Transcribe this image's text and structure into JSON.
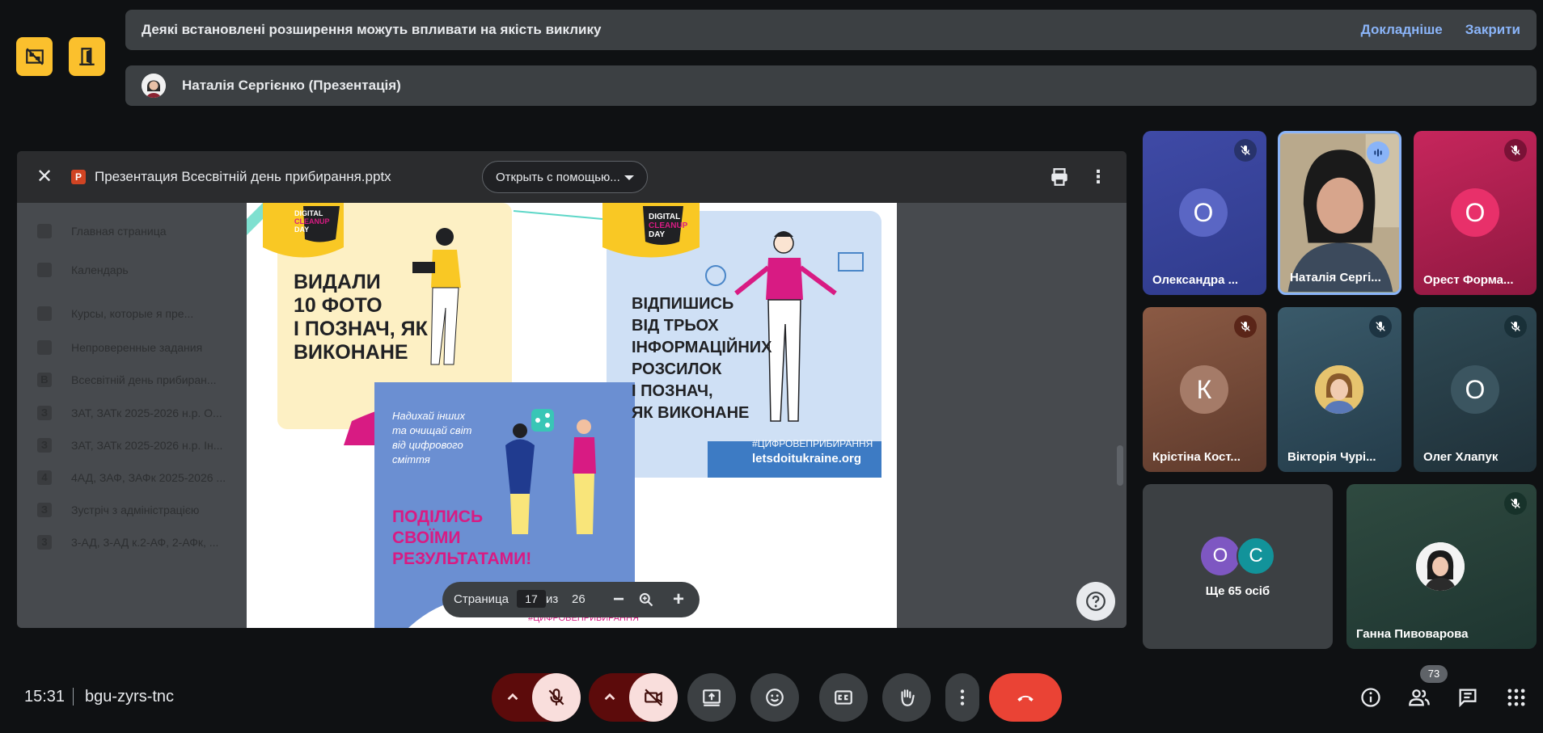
{
  "notice": {
    "message": "Деякі встановлені розширення можуть впливати на якість виклику",
    "learn_more": "Докладніше",
    "close": "Закрити"
  },
  "presenter": {
    "name": "Наталія Сергієнко (Презентація)"
  },
  "viewer": {
    "file_icon": "P",
    "file_name": "Презентация Всесвітній день прибирання.pptx",
    "open_with": "Открыть с помощью...",
    "background_items": [
      "Главная страница",
      "Календарь",
      "Курсы, которые я пре...",
      "Непроверенные задания",
      "Всесвітній день прибиран...",
      "ЗАТ, ЗАТк 2025-2026 н.р. О...",
      "ЗАТ, ЗАТк 2025-2026 н.р. Ін...",
      "4АД, ЗАФ, ЗАФк 2025-2026 ...",
      "Зустріч з адміністрацією",
      "3-АД, 3-АД к.2-АФ, 2-АФк, ..."
    ],
    "background_icons": [
      "",
      "",
      "",
      "",
      "В",
      "З",
      "З",
      "4",
      "З",
      "3"
    ],
    "pager": {
      "page_label": "Страница",
      "current": "17",
      "of_label": "из",
      "total": "26"
    }
  },
  "slide": {
    "logo_line1": "DIGITAL",
    "logo_line2": "CLEANUP",
    "logo_line3": "DAY",
    "panel1_title": [
      "ВИДАЛИ",
      "10 ФОТО",
      "І ПОЗНАЧ, ЯК",
      "ВИКОНАНЕ"
    ],
    "panel2_title": [
      "ВІДПИШИСЬ",
      "ВІД ТРЬОХ",
      "ІНФОРМАЦІЙНИХ",
      "РОЗСИЛОК",
      "І ПОЗНАЧ,",
      "ЯК ВИКОНАНЕ"
    ],
    "panel2_hashtag": "#ЦИФРОВЕПРИБИРАННЯ",
    "panel2_site": "letsdoitukraine.org",
    "panel3_intro": [
      "Надихай інших",
      "та очищай світ",
      "від цифрового",
      "сміття"
    ],
    "panel3_title": [
      "ПОДІЛИСЬ",
      "СВОЇМИ",
      "РЕЗУЛЬТАТАМИ!"
    ],
    "panel3_hashtag": "#ЦИФРОВЕПРИБИРАННЯ"
  },
  "participants": [
    {
      "name": "Олександра ...",
      "initial": "О",
      "muted": true
    },
    {
      "name": "Наталія Сергі...",
      "initial": "",
      "muted": false,
      "speaking": true
    },
    {
      "name": "Орест Форма...",
      "initial": "О",
      "muted": true
    },
    {
      "name": "Крістіна Кост...",
      "initial": "К",
      "muted": true
    },
    {
      "name": "Вікторія Чурі...",
      "initial": "",
      "muted": true
    },
    {
      "name": "Олег Хлапук",
      "initial": "О",
      "muted": true
    },
    {
      "name": "Ганна Пивоварова",
      "initial": "",
      "muted": true
    }
  ],
  "others": {
    "initials": [
      "О",
      "С"
    ],
    "label": "Ще 65 осіб"
  },
  "footer": {
    "time": "15:31",
    "meeting_code": "bgu-zyrs-tnc",
    "participants_count": "73"
  },
  "colors": {
    "accent_link": "#8ab4f8",
    "hangup": "#ea4335",
    "muted_bg": "#f9dedc",
    "yellow": "#fbc02d"
  }
}
